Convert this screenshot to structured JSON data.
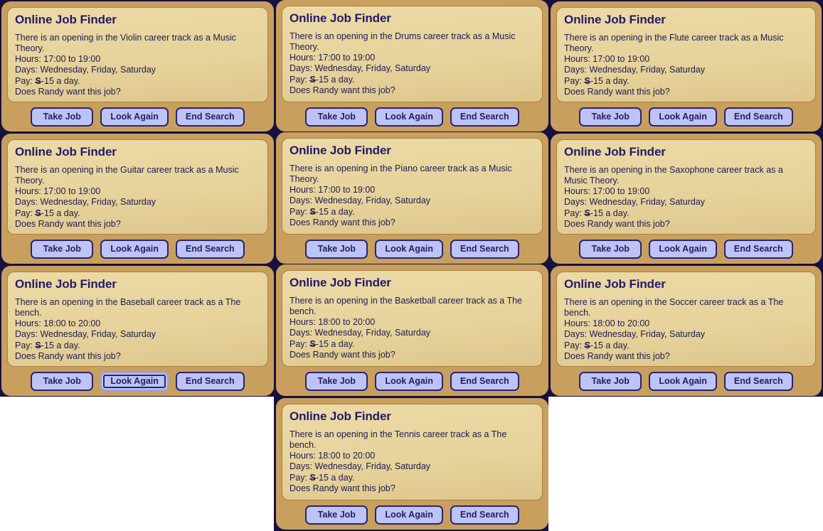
{
  "window": {
    "title": "Online Job Finder",
    "sim_name": "Randy"
  },
  "colors": {
    "backdrop": "#161140",
    "panel_frame": "#c99f5e",
    "panel_inner": "#e8d6a0",
    "text": "#1d1a52",
    "title": "#231a68",
    "button_fill": "#bdc4f5",
    "button_border": "#2a246e",
    "page_background": "#ffffff"
  },
  "buttons": {
    "take_job": "Take Job",
    "look_again": "Look Again",
    "end_search": "End Search"
  },
  "labels": {
    "hours_prefix": "Hours: ",
    "days_prefix": "Days: ",
    "pay_prefix": "Pay: ",
    "currency": "S",
    "pay_suffix": "-15 a day.",
    "question": "Does Randy want this job?"
  },
  "panels": [
    {
      "title": "Online Job Finder",
      "career": "Violin",
      "role": "Music Theory",
      "description": "There is an opening in the Violin career track as a Music Theory.",
      "hours": "17:00 to 19:00",
      "days": "Wednesday, Friday, Saturday",
      "pay": "-15 a day.",
      "question": "Does Randy want this job?",
      "focused_button": null
    },
    {
      "title": "Online Job Finder",
      "career": "Drums",
      "role": "Music Theory",
      "description": "There is an opening in the Drums career track as a Music Theory.",
      "hours": "17:00 to 19:00",
      "days": "Wednesday, Friday, Saturday",
      "pay": "-15 a day.",
      "question": "Does Randy want this job?",
      "focused_button": null
    },
    {
      "title": "Online Job Finder",
      "career": "Flute",
      "role": "Music Theory",
      "description": "There is an opening in the Flute career track as a Music Theory.",
      "hours": "17:00 to 19:00",
      "days": "Wednesday, Friday, Saturday",
      "pay": "-15 a day.",
      "question": "Does Randy want this job?",
      "focused_button": null
    },
    {
      "title": "Online Job Finder",
      "career": "Guitar",
      "role": "Music Theory",
      "description": "There is an opening in the Guitar career track as a Music Theory.",
      "hours": "17:00 to 19:00",
      "days": "Wednesday, Friday, Saturday",
      "pay": "-15 a day.",
      "question": "Does Randy want this job?",
      "focused_button": null
    },
    {
      "title": "Online Job Finder",
      "career": "Piano",
      "role": "Music Theory",
      "description": "There is an opening in the Piano career track as a Music Theory.",
      "hours": "17:00 to 19:00",
      "days": "Wednesday, Friday, Saturday",
      "pay": "-15 a day.",
      "question": "Does Randy want this job?",
      "focused_button": null
    },
    {
      "title": "Online Job Finder",
      "career": "Saxophone",
      "role": "Music Theory",
      "description": "There is an opening in the Saxophone career track as a Music Theory.",
      "hours": "17:00 to 19:00",
      "days": "Wednesday, Friday, Saturday",
      "pay": "-15 a day.",
      "question": "Does Randy want this job?",
      "focused_button": null
    },
    {
      "title": "Online Job Finder",
      "career": "Baseball",
      "role": "The bench",
      "description": "There is an opening in the Baseball career track as a The bench.",
      "hours": "18:00 to 20:00",
      "days": "Wednesday, Friday, Saturday",
      "pay": "-15 a day.",
      "question": "Does Randy want this job?",
      "focused_button": "look_again"
    },
    {
      "title": "Online Job Finder",
      "career": "Basketball",
      "role": "The bench",
      "description": "There is an opening in the Basketball career track as a The bench.",
      "hours": "18:00 to 20:00",
      "days": "Wednesday, Friday, Saturday",
      "pay": "-15 a day.",
      "question": "Does Randy want this job?",
      "focused_button": null
    },
    {
      "title": "Online Job Finder",
      "career": "Soccer",
      "role": "The bench",
      "description": "There is an opening in the Soccer career track as a The bench.",
      "hours": "18:00 to 20:00",
      "days": "Wednesday, Friday, Saturday",
      "pay": "-15 a day.",
      "question": "Does Randy want this job?",
      "focused_button": null
    },
    {
      "title": "Online Job Finder",
      "career": "Tennis",
      "role": "The bench",
      "description": "There is an opening in the Tennis career track as a The bench.",
      "hours": "18:00 to 20:00",
      "days": "Wednesday, Friday, Saturday",
      "pay": "-15 a day.",
      "question": "Does Randy want this job?",
      "focused_button": null
    }
  ]
}
